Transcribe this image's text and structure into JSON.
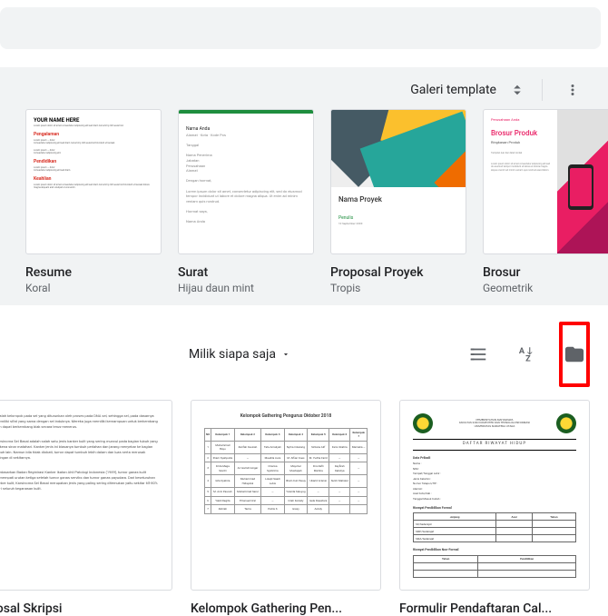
{
  "search": {
    "placeholder": ""
  },
  "templateHeader": {
    "label": "Galeri template"
  },
  "templates": [
    {
      "title": "Resume",
      "subtitle": "Koral"
    },
    {
      "title": "Surat",
      "subtitle": "Hijau daun mint"
    },
    {
      "title": "Proposal Proyek",
      "subtitle": "Tropis"
    },
    {
      "title": "Brosur",
      "subtitle": "Geometrik"
    }
  ],
  "proposalThumb": {
    "title": "Nama Proyek",
    "author": "Penulis",
    "date": "10 September 20XX"
  },
  "brosurThumb": {
    "company": "Perusahaan Anda",
    "heading": "Brosur Produk",
    "sub": "Ringkasan Produk",
    "tag": "Tampilan luar dan dalam kotak"
  },
  "resumeThumb": {
    "name": "YOUR NAME HERE",
    "sections": [
      "Pengalaman",
      "Pendidikan",
      "Keahlian"
    ]
  },
  "toolbar": {
    "ownerFilter": "Milik siapa saja"
  },
  "docs": [
    {
      "title": "oposal Skripsi"
    },
    {
      "title": "Kelompok Gathering Pen..."
    },
    {
      "title": "Formulir Pendaftaran Cal..."
    }
  ],
  "gatheringDoc": {
    "header": "Kelompok Gathering Pengurus Oktober 2018",
    "cols": [
      "NO",
      "Kelompok 1",
      "Kelompok 2",
      "Kelompok 3",
      "Kelompok 4",
      "Kelompok 5",
      "Kelompok 6",
      "Kelompok 7"
    ],
    "rows": [
      [
        "1",
        "Muhammad Bayu",
        "Zarifah Fauziah",
        "Tata Amaliyah",
        "Nyiha Cikarang",
        "Sirliana Alif",
        "Faris Okatria",
        "Mamelia —"
      ],
      [
        "2",
        "Ilham Syahputra",
        "—",
        "Maudila Aura",
        "M. Alfian Koes",
        "M. Yudha Farid",
        "—",
        "—"
      ],
      [
        "3",
        "Frida Mega Savitri",
        "Ari Gamdi Ginger",
        "Charisa Syahrima",
        "Maychel Mustapah",
        "Fira Rafli Marlina",
        "Deyfirah Delistya",
        "—"
      ],
      [
        "4",
        "Gita Syahira",
        "Muhammad Hidayatul",
        "Lolept Saadi Lubis",
        "Ilham Kuli Pasuy",
        "Ukarid Ariansi",
        "Sulim Mahalul",
        "—"
      ],
      [
        "5",
        "M. Aziz Pascah",
        "Muhammad Serul",
        "—",
        "Yolanta Saluyog",
        "—",
        "—",
        "—"
      ],
      [
        "6",
        "Yakili Regita",
        "Emanuel Oral",
        "—",
        "Inleh Feniaty",
        "Gela Kleestara",
        "—",
        "—"
      ],
      [
        "7",
        "Zahrah",
        "Tama",
        "Patris S",
        "Gresy",
        "Astuty",
        "",
        ""
      ]
    ]
  },
  "formDoc": {
    "org1": "PEMERINTAHAN MAHASISWA",
    "org2": "FAKULTAS ILMU KOMPUTER DAN TEKNOLOGI INFORMASI",
    "org3": "UNIVERSITAS SUMATERA UTARA",
    "title": "DAFTAR RIWAYAT HIDUP",
    "section1": "Data Pribadi",
    "fields": [
      "Nama",
      "NIM",
      "Tempat/Tanggal Lahir",
      "Jenis Kelamin",
      "Nomor Telepon/HP",
      "Alamat",
      "Asal Kota/Kab",
      "Tanggal Masuk Kuliah"
    ],
    "section2": "Riwayat Pendidikan Formal",
    "cols2": [
      "Jenjang",
      "Asal",
      "Tahun"
    ],
    "rows2": [
      "SD/Sederajat",
      "SMP/Sederajat",
      "SMA/Sederajat"
    ],
    "section3": "Riwayat Pendidikan Non-Formal",
    "cols3": [
      "Tahun",
      "Pendidikan"
    ]
  }
}
